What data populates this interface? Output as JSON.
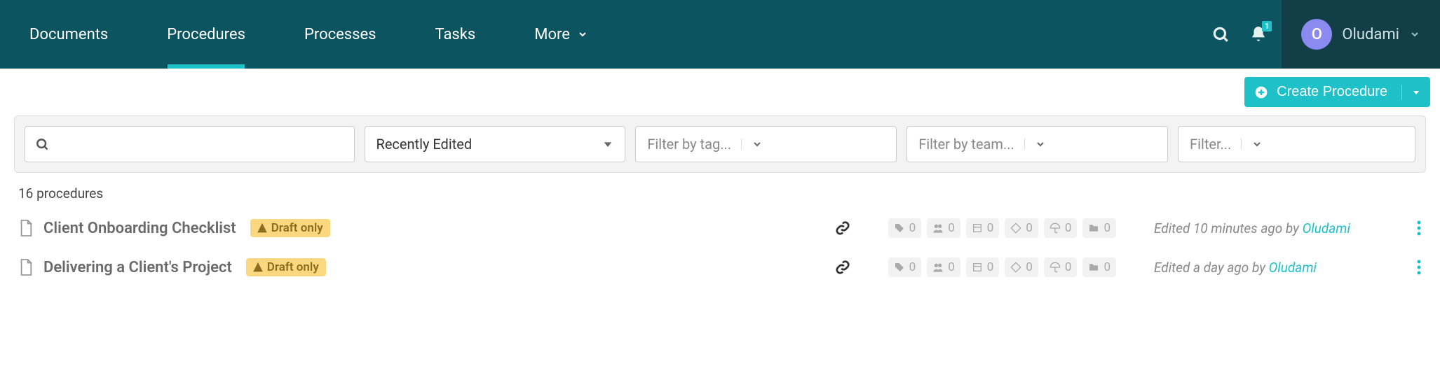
{
  "nav": {
    "tabs": [
      "Documents",
      "Procedures",
      "Processes",
      "Tasks",
      "More"
    ],
    "active_index": 1,
    "notification_count": "1",
    "user": {
      "initial": "O",
      "name": "Oludami"
    }
  },
  "actions": {
    "create_label": "Create Procedure"
  },
  "filters": {
    "sort_value": "Recently Edited",
    "tag_placeholder": "Filter by tag...",
    "team_placeholder": "Filter by team...",
    "generic_placeholder": "Filter..."
  },
  "list": {
    "count_text": "16 procedures",
    "badge_label": "Draft only",
    "items": [
      {
        "title": "Client Onboarding Checklist",
        "stats": [
          "0",
          "0",
          "0",
          "0",
          "0",
          "0"
        ],
        "edited_prefix": "Edited 10 minutes ago by ",
        "edited_user": "Oludami"
      },
      {
        "title": "Delivering a Client's Project",
        "stats": [
          "0",
          "0",
          "0",
          "0",
          "0",
          "0"
        ],
        "edited_prefix": "Edited a day ago by ",
        "edited_user": "Oludami"
      }
    ]
  }
}
